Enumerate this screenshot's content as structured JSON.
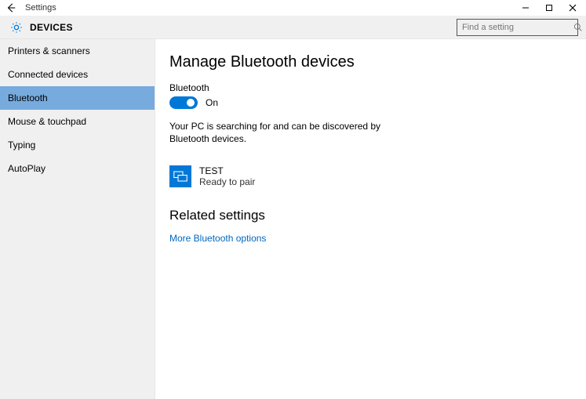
{
  "titlebar": {
    "title": "Settings"
  },
  "header": {
    "title": "DEVICES",
    "search_placeholder": "Find a setting"
  },
  "sidebar": {
    "items": [
      {
        "label": "Printers & scanners",
        "selected": false
      },
      {
        "label": "Connected devices",
        "selected": false
      },
      {
        "label": "Bluetooth",
        "selected": true
      },
      {
        "label": "Mouse & touchpad",
        "selected": false
      },
      {
        "label": "Typing",
        "selected": false
      },
      {
        "label": "AutoPlay",
        "selected": false
      }
    ]
  },
  "main": {
    "heading": "Manage Bluetooth devices",
    "toggle_label": "Bluetooth",
    "toggle_state_label": "On",
    "toggle_on": true,
    "status_text": "Your PC is searching for and can be discovered by Bluetooth devices.",
    "device": {
      "name": "TEST",
      "status": "Ready to pair"
    },
    "related_heading": "Related settings",
    "more_link": "More Bluetooth options"
  }
}
